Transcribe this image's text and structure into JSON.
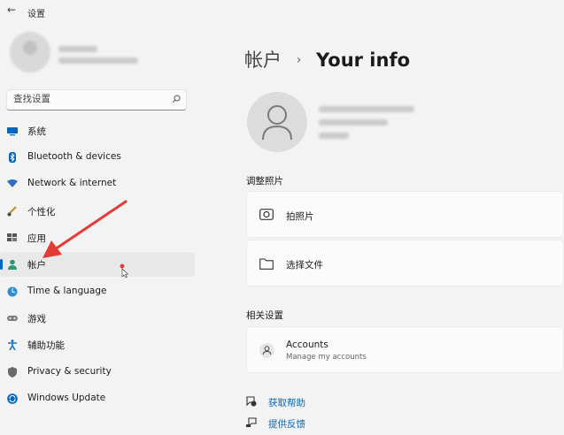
{
  "app": {
    "title": "设置",
    "back_icon": "back-arrow-icon"
  },
  "search": {
    "placeholder": "查找设置",
    "value": ""
  },
  "nav": {
    "items": [
      {
        "label": "系统",
        "icon": "system-icon",
        "color": "#0067c0"
      },
      {
        "label": "Bluetooth & devices",
        "icon": "bluetooth-icon",
        "color": "#0067c0"
      },
      {
        "label": "Network & internet",
        "icon": "network-icon",
        "color": "#2e6fbf"
      },
      {
        "label": "个性化",
        "icon": "personalization-icon",
        "color": "#c48b2a"
      },
      {
        "label": "应用",
        "icon": "apps-icon",
        "color": "#555555"
      },
      {
        "label": "帐户",
        "icon": "accounts-icon",
        "color": "#2c9a6a",
        "active": true
      },
      {
        "label": "Time & language",
        "icon": "time-language-icon",
        "color": "#2b8fd1"
      },
      {
        "label": "游戏",
        "icon": "gaming-icon",
        "color": "#7d7d7d"
      },
      {
        "label": "辅助功能",
        "icon": "accessibility-icon",
        "color": "#1a73c7"
      },
      {
        "label": "Privacy & security",
        "icon": "privacy-shield-icon",
        "color": "#6b6b6b"
      },
      {
        "label": "Windows Update",
        "icon": "windows-update-icon",
        "color": "#0067c0"
      }
    ]
  },
  "header": {
    "crumb_parent": "帐户",
    "separator": "›",
    "crumb_current": "Your info"
  },
  "photo_section": {
    "label": "调整照片",
    "take_photo": {
      "label": "拍照片",
      "icon": "camera-icon"
    },
    "choose_file": {
      "label": "选择文件",
      "icon": "folder-icon"
    }
  },
  "related_section": {
    "label": "相关设置",
    "accounts": {
      "label": "Accounts",
      "sub": "Manage my accounts",
      "icon": "person-icon"
    }
  },
  "footer_links": [
    {
      "label": "获取帮助",
      "icon": "help-icon"
    },
    {
      "label": "提供反馈",
      "icon": "feedback-icon"
    }
  ],
  "colors": {
    "accent": "#0067c0",
    "annotation_arrow": "#e33b35"
  }
}
